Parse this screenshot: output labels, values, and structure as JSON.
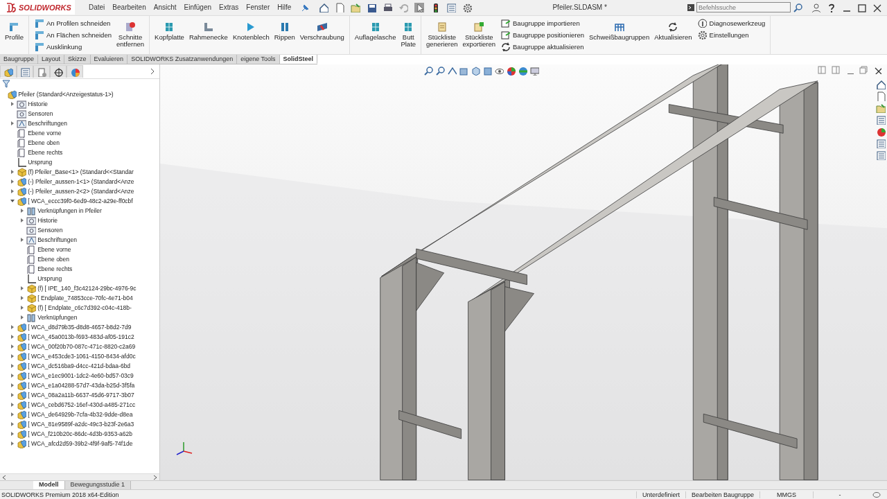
{
  "titlebar": {
    "logo": "SOLIDWORKS",
    "menu": [
      "Datei",
      "Bearbeiten",
      "Ansicht",
      "Einfügen",
      "Extras",
      "Fenster",
      "Hilfe"
    ],
    "document_title": "Pfeiler.SLDASM *",
    "search": {
      "placeholder": "Befehlssuche"
    }
  },
  "ribbon": {
    "groups": [
      {
        "items": [
          {
            "kind": "large",
            "label": "Profile"
          }
        ]
      },
      {
        "items": [
          {
            "kind": "stack",
            "entries": [
              "An Profilen schneiden",
              "An Flächen schneiden",
              "Ausklinkung"
            ]
          },
          {
            "kind": "large",
            "label": "Schnitte entfernen"
          }
        ]
      },
      {
        "items": [
          {
            "kind": "large",
            "label": "Kopfplatte"
          },
          {
            "kind": "large",
            "label": "Rahmenecke"
          },
          {
            "kind": "large",
            "label": "Knotenblech"
          },
          {
            "kind": "large",
            "label": "Rippen"
          },
          {
            "kind": "large",
            "label": "Verschraubung"
          }
        ]
      },
      {
        "items": [
          {
            "kind": "large",
            "label": "Auflagelasche"
          },
          {
            "kind": "large",
            "label": "Butt Plate"
          }
        ]
      },
      {
        "items": [
          {
            "kind": "large",
            "label": "Stückliste generieren"
          },
          {
            "kind": "large",
            "label": "Stückliste exportieren"
          },
          {
            "kind": "stack",
            "entries": [
              "Baugruppe importieren",
              "Baugruppe positionieren",
              "Baugruppe aktualisieren"
            ]
          },
          {
            "kind": "large",
            "label": "Schweißbaugruppen"
          },
          {
            "kind": "large",
            "label": "Aktualisieren"
          },
          {
            "kind": "stack",
            "entries": [
              "Diagnosewerkzeug",
              "Einstellungen"
            ]
          }
        ]
      }
    ]
  },
  "command_tabs": [
    {
      "label": "Baugruppe",
      "selected": false
    },
    {
      "label": "Layout",
      "selected": false
    },
    {
      "label": "Skizze",
      "selected": false
    },
    {
      "label": "Evaluieren",
      "selected": false
    },
    {
      "label": "SOLIDWORKS Zusatzanwendungen",
      "selected": false
    },
    {
      "label": "eigene Tools",
      "selected": false
    },
    {
      "label": "SolidSteel",
      "selected": true
    }
  ],
  "tree": {
    "items": [
      {
        "kind": "assembly",
        "label": "Pfeiler  (Standard<Anzeigestatus-1>)",
        "children": [
          {
            "kind": "history",
            "label": "Historie",
            "expanded": false
          },
          {
            "kind": "sensors",
            "label": "Sensoren"
          },
          {
            "kind": "annotations",
            "label": "Beschriftungen",
            "expanded": false
          },
          {
            "kind": "plane",
            "label": "Ebene vorne"
          },
          {
            "kind": "plane",
            "label": "Ebene oben"
          },
          {
            "kind": "plane",
            "label": "Ebene rechts"
          },
          {
            "kind": "origin",
            "label": "Ursprung"
          },
          {
            "kind": "part",
            "label": "(f) Pfeiler_Base<1> (Standard<<Standar",
            "expanded": false
          },
          {
            "kind": "assembly",
            "label": "(-) Pfeiler_aussen-1<1> (Standard<Anze",
            "expanded": false
          },
          {
            "kind": "assembly",
            "label": "(-) Pfeiler_aussen-2<2> (Standard<Anze",
            "expanded": false
          },
          {
            "kind": "assembly",
            "label": "[ WCA_eccc39f0-6ed9-48c2-a29e-ff0cbf",
            "expanded": true,
            "children": [
              {
                "kind": "mates",
                "label": "Verknüpfungen in Pfeiler",
                "expanded": false
              },
              {
                "kind": "history",
                "label": "Historie",
                "expanded": false
              },
              {
                "kind": "sensors",
                "label": "Sensoren"
              },
              {
                "kind": "annotations",
                "label": "Beschriftungen",
                "expanded": false
              },
              {
                "kind": "plane",
                "label": "Ebene vorne"
              },
              {
                "kind": "plane",
                "label": "Ebene oben"
              },
              {
                "kind": "plane",
                "label": "Ebene rechts"
              },
              {
                "kind": "origin",
                "label": "Ursprung"
              },
              {
                "kind": "part",
                "label": "(f) [ IPE_140_f3c42124-29bc-4976-9c",
                "expanded": false
              },
              {
                "kind": "part",
                "label": "[ Endplate_74853cce-70fc-4e71-b04",
                "expanded": false
              },
              {
                "kind": "part",
                "label": "(f) [ Endplate_c6c7d392-c04c-418b-",
                "expanded": false
              },
              {
                "kind": "mates",
                "label": "Verknüpfungen",
                "expanded": false
              }
            ]
          },
          {
            "kind": "assembly",
            "label": "[ WCA_d8d79b35-d8d8-4657-b8d2-7d9",
            "expanded": false
          },
          {
            "kind": "assembly",
            "label": "[ WCA_45a0013b-f693-483d-af05-191c2",
            "expanded": false
          },
          {
            "kind": "assembly",
            "label": "[ WCA_00f20b70-087c-471c-8820-c2a69",
            "expanded": false
          },
          {
            "kind": "assembly",
            "label": "[ WCA_e453cde3-1061-4150-8434-afd0c",
            "expanded": false
          },
          {
            "kind": "assembly",
            "label": "[ WCA_dc516ba9-d4cc-421d-bdaa-6bd",
            "expanded": false
          },
          {
            "kind": "assembly",
            "label": "[ WCA_e1ec9001-1dc2-4e60-bd57-03c9",
            "expanded": false
          },
          {
            "kind": "assembly",
            "label": "[ WCA_e1a04288-57d7-43da-b25d-3f5fa",
            "expanded": false
          },
          {
            "kind": "assembly",
            "label": "[ WCA_08a2a11b-6637-45d6-9717-3b07",
            "expanded": false
          },
          {
            "kind": "assembly",
            "label": "[ WCA_cebd6752-16ef-430d-a485-271cc",
            "expanded": false
          },
          {
            "kind": "assembly",
            "label": "[ WCA_de64929b-7cfa-4b32-9dde-d8ea",
            "expanded": false
          },
          {
            "kind": "assembly",
            "label": "[ WCA_81e9589f-a2dc-49c3-b23f-2e6a3",
            "expanded": false
          },
          {
            "kind": "assembly",
            "label": "[ WCA_f210b20c-86dc-4d3b-9353-a62b",
            "expanded": false
          },
          {
            "kind": "assembly",
            "label": "[ WCA_afcd2d59-39b2-4f9f-9af5-74f1de",
            "expanded": false
          }
        ]
      }
    ]
  },
  "bottom_tabs": [
    {
      "label": "Modell",
      "selected": true
    },
    {
      "label": "Bewegungsstudie 1",
      "selected": false
    }
  ],
  "status_bar": {
    "product": "SOLIDWORKS Premium 2018 x64-Edition",
    "fields": [
      "Unterdefiniert",
      "Bearbeiten Baugruppe",
      "MMGS",
      "-"
    ]
  }
}
